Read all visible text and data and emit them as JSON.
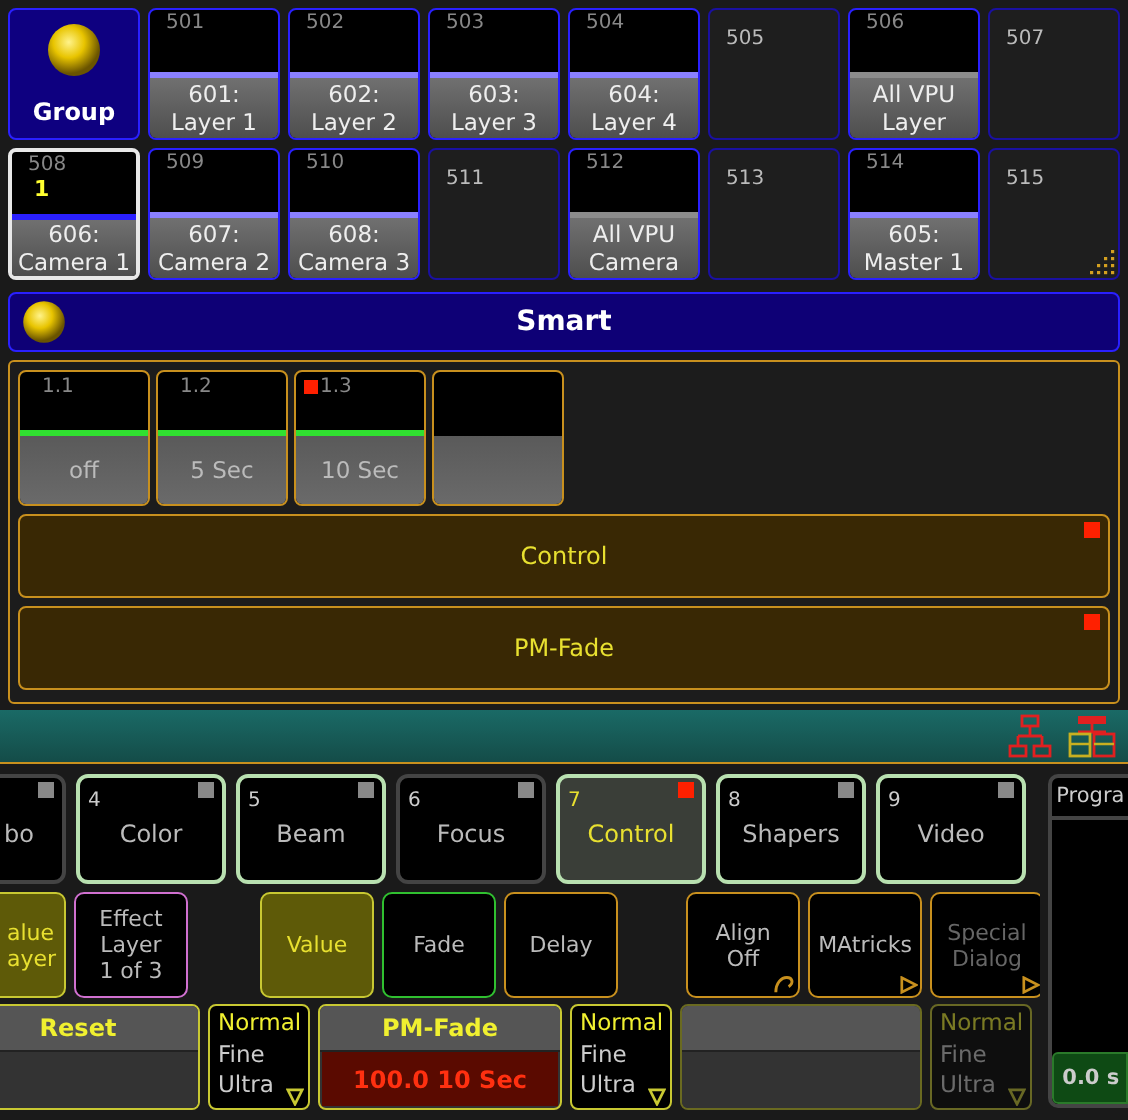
{
  "group_pool": {
    "title": "Group",
    "cells": [
      {
        "kind": "filled",
        "number": "501",
        "label": "601:\nLayer 1",
        "color": "#8a80ff",
        "selected": false
      },
      {
        "kind": "filled",
        "number": "502",
        "label": "602:\nLayer 2",
        "color": "#8a80ff",
        "selected": false
      },
      {
        "kind": "filled",
        "number": "503",
        "label": "603:\nLayer 3",
        "color": "#8a80ff",
        "selected": false
      },
      {
        "kind": "filled",
        "number": "504",
        "label": "604:\nLayer 4",
        "color": "#8a80ff",
        "selected": false
      },
      {
        "kind": "empty",
        "number": "505"
      },
      {
        "kind": "filled",
        "number": "506",
        "label": "All VPU\nLayer",
        "color": "#8c8c8c",
        "selected": false
      },
      {
        "kind": "empty",
        "number": "507"
      },
      {
        "kind": "filled",
        "number": "508",
        "label": "606:\nCamera 1",
        "color": "#2a20ff",
        "selected": true,
        "selection_index": "1"
      },
      {
        "kind": "filled",
        "number": "509",
        "label": "607:\nCamera 2",
        "color": "#8a80ff",
        "selected": false
      },
      {
        "kind": "filled",
        "number": "510",
        "label": "608:\nCamera 3",
        "color": "#8a80ff",
        "selected": false
      },
      {
        "kind": "empty",
        "number": "511"
      },
      {
        "kind": "filled",
        "number": "512",
        "label": "All VPU\nCamera",
        "color": "#8c8c8c",
        "selected": false
      },
      {
        "kind": "empty",
        "number": "513"
      },
      {
        "kind": "filled",
        "number": "514",
        "label": "605:\nMaster 1",
        "color": "#8a80ff",
        "selected": false
      },
      {
        "kind": "empty",
        "number": "515"
      }
    ]
  },
  "smart": {
    "title": "Smart",
    "presets": [
      {
        "kind": "preset",
        "number": "1.1",
        "label": "off",
        "marked": false
      },
      {
        "kind": "preset",
        "number": "1.2",
        "label": "5 Sec",
        "marked": false
      },
      {
        "kind": "preset",
        "number": "1.3",
        "label": "10 Sec",
        "marked": true
      },
      {
        "kind": "empty"
      }
    ],
    "bars": [
      {
        "label": "Control",
        "marked": true
      },
      {
        "label": "PM-Fade",
        "marked": true
      }
    ]
  },
  "features": [
    {
      "label": "bo",
      "active": false,
      "selected": false,
      "marked": false
    },
    {
      "number": "4",
      "label": "Color",
      "active": true,
      "selected": false,
      "marked": false
    },
    {
      "number": "5",
      "label": "Beam",
      "active": true,
      "selected": false,
      "marked": false
    },
    {
      "number": "6",
      "label": "Focus",
      "active": false,
      "selected": false,
      "marked": false
    },
    {
      "number": "7",
      "label": "Control",
      "active": true,
      "selected": true,
      "marked": true
    },
    {
      "number": "8",
      "label": "Shapers",
      "active": true,
      "selected": false,
      "marked": false
    },
    {
      "number": "9",
      "label": "Video",
      "active": true,
      "selected": false,
      "marked": false
    }
  ],
  "buttons": [
    {
      "kind": "plain",
      "label": "alue\nayer",
      "color": "#c8c832",
      "selected": true,
      "disabled": false
    },
    {
      "kind": "plain",
      "label": "Effect\nLayer\n1 of 3",
      "color": "#d070d0",
      "selected": false,
      "disabled": false
    },
    {
      "kind": "plain",
      "label": "Value",
      "color": "#c8c832",
      "selected": true,
      "disabled": false
    },
    {
      "kind": "plain",
      "label": "Fade",
      "color": "#30c030",
      "selected": false,
      "disabled": false
    },
    {
      "kind": "plain",
      "label": "Delay",
      "color": "#c8901e",
      "selected": false,
      "disabled": false
    },
    {
      "kind": "curl",
      "label": "Align\nOff",
      "color": "#c8901e",
      "selected": false,
      "disabled": false
    },
    {
      "kind": "menu",
      "label": "MAtricks",
      "color": "#c8901e",
      "selected": false,
      "disabled": false
    },
    {
      "kind": "menu",
      "label": "Special\nDialog",
      "color": "#c8901e",
      "selected": false,
      "disabled": true
    }
  ],
  "encoders": [
    {
      "kind": "encoder",
      "title": "Reset"
    },
    {
      "kind": "resolution",
      "disabled": false,
      "options": [
        {
          "label": "Normal",
          "selected": true
        },
        {
          "label": "Fine",
          "selected": false
        },
        {
          "label": "Ultra",
          "selected": false
        }
      ]
    },
    {
      "kind": "encoder",
      "title": "PM-Fade",
      "value": "100.0 10 Sec"
    },
    {
      "kind": "resolution",
      "disabled": false,
      "options": [
        {
          "label": "Normal",
          "selected": true
        },
        {
          "label": "Fine",
          "selected": false
        },
        {
          "label": "Ultra",
          "selected": false
        }
      ]
    },
    {
      "kind": "encoder"
    },
    {
      "kind": "resolution",
      "disabled": true,
      "options": [
        {
          "label": "Normal",
          "selected": true
        },
        {
          "label": "Fine",
          "selected": false
        },
        {
          "label": "Ultra",
          "selected": false
        }
      ]
    }
  ],
  "program": {
    "title": "Progra",
    "time": "0.0 s"
  }
}
